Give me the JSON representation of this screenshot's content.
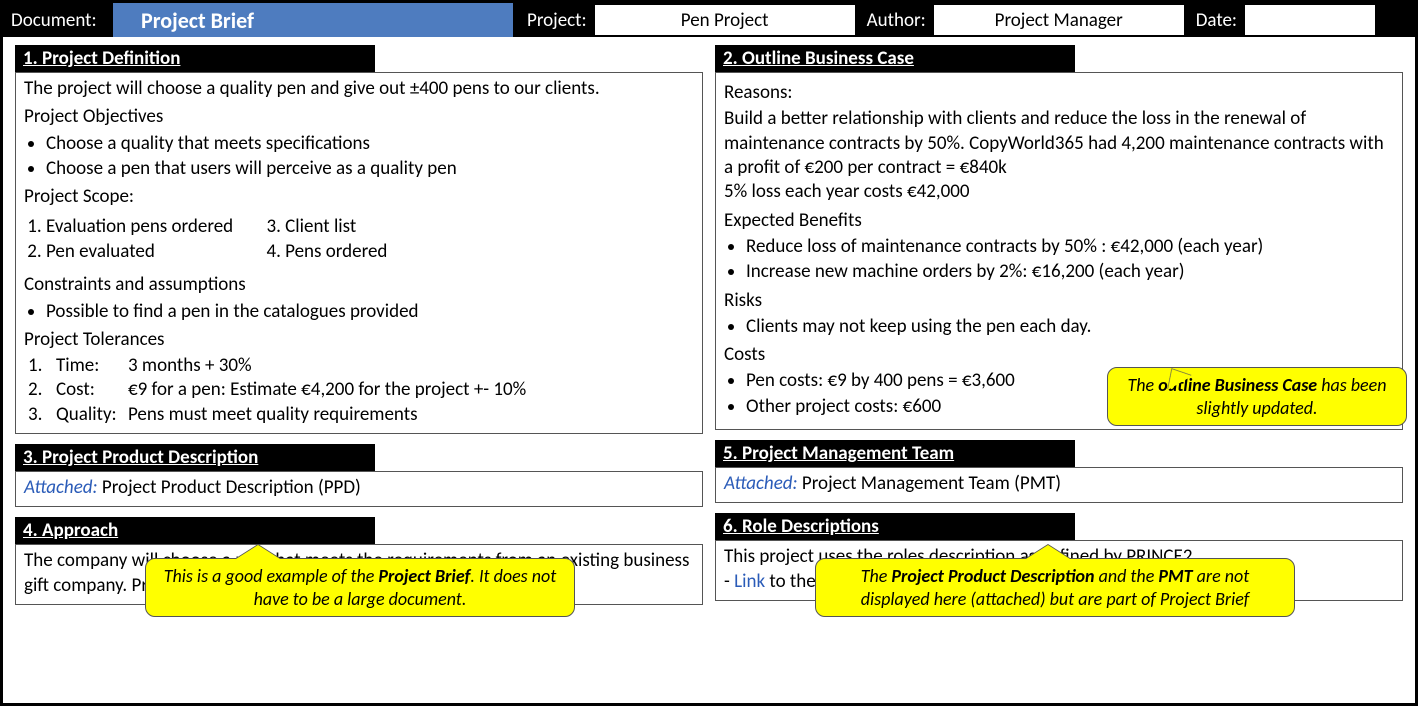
{
  "header": {
    "doc_label": "Document:",
    "doc_name": "Project Brief",
    "project_label": "Project:",
    "project_value": "Pen Project",
    "author_label": "Author:",
    "author_value": "Project Manager",
    "date_label": "Date:",
    "date_value": ""
  },
  "sections": {
    "definition": {
      "title": "1. Project Definition",
      "intro": "The project will choose a quality pen and give out ±400 pens to our clients.",
      "objectives_head": "Project Objectives",
      "objectives": [
        "Choose a quality that meets specifications",
        "Choose a pen that users will perceive as a quality pen"
      ],
      "scope_head": "Project Scope:",
      "scope": [
        "Evaluation pens ordered",
        "Pen evaluated",
        "Client list",
        "Pens ordered"
      ],
      "constraints_head": "Constraints and assumptions",
      "constraints": [
        "Possible to find a pen in the catalogues provided"
      ],
      "tolerances_head": "Project Tolerances",
      "tolerances": [
        {
          "k": "Time:",
          "v": "3 months + 30%"
        },
        {
          "k": "Cost:",
          "v": "€9 for a pen: Estimate €4,200 for the project +- 10%"
        },
        {
          "k": "Quality:",
          "v": "Pens must meet quality requirements"
        }
      ]
    },
    "ppd": {
      "title": "3. Project Product Description",
      "attached_label": "Attached:",
      "attached_text": "Project Product Description (PPD)"
    },
    "approach": {
      "title": "4. Approach",
      "text": "The company will choose a pen that meets the requirements from an existing business gift company. Project will be run internally."
    },
    "business_case": {
      "title": "2. Outline Business Case",
      "reasons_head": "Reasons:",
      "reasons_text": "Build a better relationship with clients and reduce the loss in the renewal of maintenance contracts by 50%. CopyWorld365 had 4,200 maintenance contracts with a profit of €200 per contract = €840k",
      "loss_line": "5% loss each year costs €42,000",
      "benefits_head": "Expected Benefits",
      "benefits": [
        "Reduce loss of maintenance contracts by 50% : €42,000 (each year)",
        "Increase new machine orders by 2%: €16,200 (each year)"
      ],
      "risks_head": "Risks",
      "risks": [
        "Clients may not keep using the pen each day."
      ],
      "costs_head": "Costs",
      "costs": [
        "Pen costs: €9 by 400 pens = €3,600",
        "Other project costs: €600"
      ]
    },
    "pmt": {
      "title": "5. Project Management Team",
      "attached_label": "Attached:",
      "attached_text": "Project Management Team (PMT)"
    },
    "roles": {
      "title": "6. Role Descriptions",
      "line1": "This project uses the roles description as defined by PRINCE2",
      "link_prefix": "- ",
      "link_text": "Link",
      "link_suffix": " to the Roles Descriptions document"
    }
  },
  "callouts": {
    "left_bottom_pre": "This is a good example of the ",
    "left_bottom_bold": "Project Brief",
    "left_bottom_post": ". It does not have to be a large document.",
    "right_mid_pre": "The ",
    "right_mid_bold": "outline Business Case",
    "right_mid_post": " has been slightly updated.",
    "right_bottom_pre": "The ",
    "right_bottom_bold1": "Project Product Description",
    "right_bottom_mid": " and the ",
    "right_bottom_bold2": "PMT",
    "right_bottom_post": " are not displayed here (attached) but are part of Project Brief"
  }
}
